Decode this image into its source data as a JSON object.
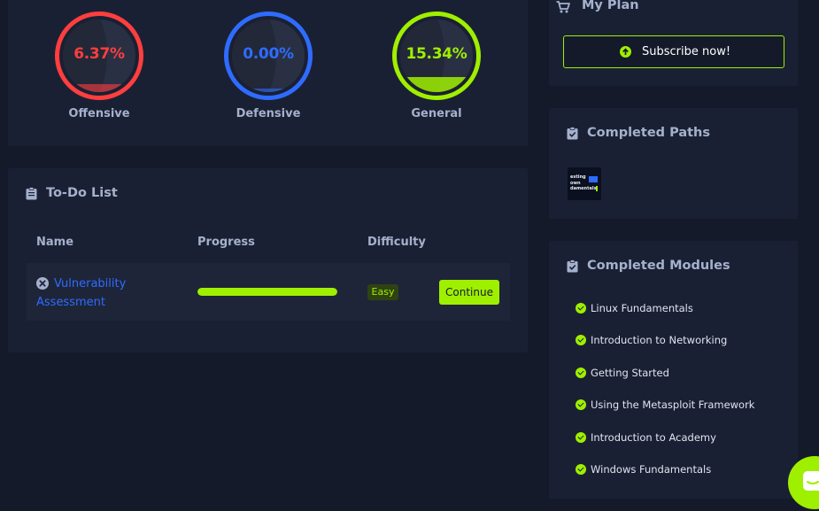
{
  "stats": [
    {
      "id": "offensive",
      "percent": "6.37%",
      "label": "Offensive",
      "color": "#ff3e3e",
      "value": 6.37
    },
    {
      "id": "defensive",
      "percent": "0.00%",
      "label": "Defensive",
      "color": "#2e6cff",
      "value": 0.0
    },
    {
      "id": "general",
      "percent": "15.34%",
      "label": "General",
      "color": "#9fef00",
      "value": 15.34
    }
  ],
  "my_plan": {
    "title": "My Plan",
    "subscribe_label": "Subscribe now!",
    "cart_icon": "cart-icon",
    "subscribe_icon": "arrow-up-circle-icon"
  },
  "todo": {
    "title": "To-Do List",
    "headers": {
      "name": "Name",
      "progress": "Progress",
      "difficulty": "Difficulty"
    },
    "rows": [
      {
        "name_line1": "Vulnerability",
        "name_line2": "Assessment",
        "progress": 1.0,
        "difficulty": "Easy",
        "action": "Continue"
      }
    ]
  },
  "completed_paths": {
    "title": "Completed Paths",
    "thumb_lines": [
      "esting",
      "own",
      "damentals"
    ]
  },
  "completed_modules": {
    "title": "Completed Modules",
    "items": [
      "Linux Fundamentals",
      "Introduction to Networking",
      "Getting Started",
      "Using the Metasploit Framework",
      "Introduction to Academy",
      "Windows Fundamentals"
    ]
  },
  "colors": {
    "accent": "#9fef00",
    "background": "#151a2b",
    "card": "#1a2033",
    "link": "#2e6cff"
  }
}
